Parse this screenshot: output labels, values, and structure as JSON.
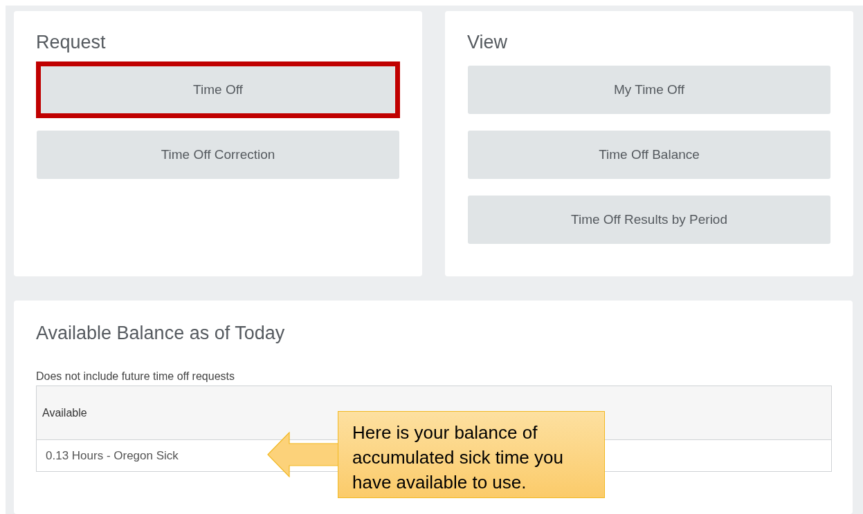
{
  "request": {
    "title": "Request",
    "buttons": [
      {
        "label": "Time Off",
        "highlighted": true
      },
      {
        "label": "Time Off Correction",
        "highlighted": false
      }
    ]
  },
  "view": {
    "title": "View",
    "buttons": [
      {
        "label": "My Time Off",
        "highlighted": false
      },
      {
        "label": "Time Off Balance",
        "highlighted": false
      },
      {
        "label": "Time Off Results by Period",
        "highlighted": false
      }
    ]
  },
  "balance": {
    "title": "Available Balance as of Today",
    "note": "Does not include future time off requests",
    "table": {
      "columns": [
        "Available"
      ],
      "rows": [
        [
          "0.13 Hours - Oregon Sick"
        ]
      ]
    }
  },
  "callout": {
    "text": "Here is your balance of accumulated sick time you have available to use."
  }
}
